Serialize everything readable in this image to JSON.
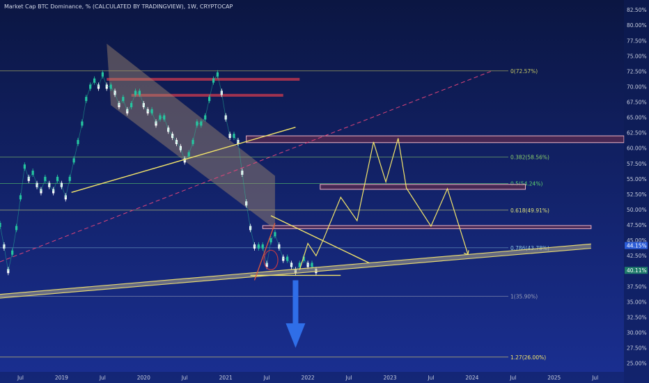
{
  "chart_data": {
    "type": "line",
    "title": "Market Cap BTC Dominance, % (CALCULATED BY TRADINGVIEW), 1W, CRYPTOCAP",
    "colors": {
      "background_top": "#0b1642",
      "background_bottom": "#1a2f92",
      "candle_up": "#26c6a0",
      "candle_down": "#ffffff",
      "drawing": "#f5e66a",
      "fib_line": "#c6c866",
      "fib_green": "#5fd46f",
      "resistance": "#d13a4e",
      "zone_fill": "#5a2a4e",
      "zone_border": "#f2b6c6",
      "arrow": "#2f6ee8",
      "dashed_trend": "#e0457a",
      "price_tag": "#2a5bd7"
    },
    "y_axis": {
      "ticks": [
        "82.50%",
        "80.00%",
        "77.50%",
        "75.00%",
        "72.50%",
        "70.00%",
        "67.50%",
        "65.00%",
        "62.50%",
        "60.00%",
        "57.50%",
        "55.00%",
        "52.50%",
        "50.00%",
        "47.50%",
        "45.00%",
        "42.50%",
        "40.00%",
        "37.50%",
        "35.00%",
        "32.50%",
        "30.00%",
        "27.50%",
        "25.00%"
      ],
      "range": [
        24.5,
        83.2
      ]
    },
    "x_axis": {
      "ticks": [
        "Jul",
        "2019",
        "Jul",
        "2020",
        "Jul",
        "2021",
        "Jul",
        "2022",
        "Jul",
        "2023",
        "Jul",
        "2024",
        "Jul",
        "2025",
        "Jul"
      ],
      "tick_dates": [
        2018.5,
        2019.0,
        2019.5,
        2020.0,
        2020.5,
        2021.0,
        2021.5,
        2022.0,
        2022.5,
        2023.0,
        2023.5,
        2024.0,
        2024.5,
        2025.0,
        2025.5
      ],
      "range": [
        2018.25,
        2025.85
      ]
    },
    "price_points": {
      "x": [
        2018.25,
        2018.3,
        2018.35,
        2018.4,
        2018.45,
        2018.5,
        2018.55,
        2018.6,
        2018.65,
        2018.7,
        2018.75,
        2018.8,
        2018.85,
        2018.9,
        2018.95,
        2019.0,
        2019.05,
        2019.1,
        2019.15,
        2019.2,
        2019.25,
        2019.3,
        2019.35,
        2019.4,
        2019.45,
        2019.5,
        2019.55,
        2019.6,
        2019.65,
        2019.7,
        2019.75,
        2019.8,
        2019.85,
        2019.9,
        2019.95,
        2020.0,
        2020.05,
        2020.1,
        2020.15,
        2020.2,
        2020.25,
        2020.3,
        2020.35,
        2020.4,
        2020.45,
        2020.5,
        2020.55,
        2020.6,
        2020.65,
        2020.7,
        2020.75,
        2020.8,
        2020.85,
        2020.9,
        2020.95,
        2021.0,
        2021.05,
        2021.1,
        2021.15,
        2021.2,
        2021.25,
        2021.3,
        2021.35,
        2021.4,
        2021.45,
        2021.5,
        2021.55,
        2021.6,
        2021.65,
        2021.7,
        2021.75,
        2021.8,
        2021.85,
        2021.9,
        2021.95,
        2022.0,
        2022.05,
        2022.1
      ],
      "y": [
        47.5,
        44,
        40,
        43,
        47,
        52,
        57,
        55,
        56,
        54,
        53,
        55,
        54,
        53,
        55,
        54,
        52,
        55,
        58,
        61,
        64,
        68,
        70,
        71,
        70,
        72,
        70,
        70,
        69,
        67,
        68,
        66,
        67,
        69,
        69,
        67,
        66,
        66,
        64,
        65,
        65,
        63,
        62,
        61,
        60,
        58,
        59,
        61,
        64,
        64,
        65,
        68,
        71,
        72,
        69,
        65,
        62,
        62,
        61,
        56,
        51,
        47,
        44,
        44,
        44,
        41,
        45,
        46,
        44,
        42,
        42,
        41,
        40,
        41,
        42,
        41,
        41,
        40
      ]
    },
    "fib_levels": [
      {
        "label": "0(72.57%)",
        "value": 72.57,
        "color": "#c6c866"
      },
      {
        "label": "0.382(58.56%)",
        "value": 58.56,
        "color": "#8cd06b"
      },
      {
        "label": "0.5(54.24%)",
        "value": 54.24,
        "color": "#5fd46f"
      },
      {
        "label": "0.618(49.91%)",
        "value": 49.91,
        "color": "#e0e27a"
      },
      {
        "label": "0.786(43.78%)",
        "value": 43.78,
        "color": "#8cc8e0"
      },
      {
        "label": "1(35.90%)",
        "value": 35.9,
        "color": "#9aa0b8"
      },
      {
        "label": "1.27(26.00%)",
        "value": 26.0,
        "color": "#f5e66a"
      }
    ],
    "resistance_lines": [
      {
        "from": 2019.55,
        "to": 2021.9,
        "value": 71.2
      },
      {
        "from": 2019.85,
        "to": 2021.7,
        "value": 68.6
      }
    ],
    "zones": [
      {
        "from": 2021.25,
        "to": 2025.85,
        "low": 60.9,
        "high": 62.0
      },
      {
        "from": 2022.15,
        "to": 2024.65,
        "low": 53.3,
        "high": 54.1
      },
      {
        "from": 2021.45,
        "to": 2025.45,
        "low": 46.9,
        "high": 47.4
      }
    ],
    "projection_path": {
      "x": [
        2021.9,
        2022.0,
        2022.1,
        2022.2,
        2022.4,
        2022.6,
        2022.8,
        2022.95,
        2023.1,
        2023.2,
        2023.5,
        2023.7,
        2023.95
      ],
      "y": [
        40.2,
        44.5,
        42.5,
        45.5,
        52,
        48.2,
        61,
        54.5,
        61.6,
        53.5,
        47.3,
        53.4,
        42.7
      ]
    },
    "price_tags": [
      "44.15%",
      "40.11%"
    ]
  }
}
